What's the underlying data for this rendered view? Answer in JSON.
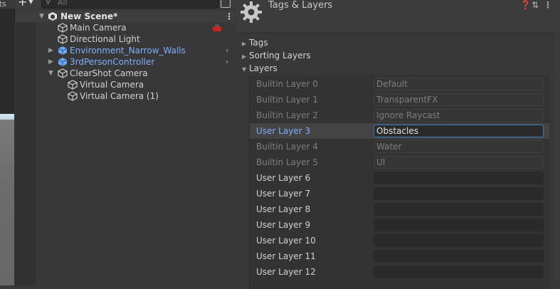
{
  "viewport": {
    "tab_fragment": "ats"
  },
  "hierarchy": {
    "search_placeholder": "All",
    "scene_name": "New Scene*",
    "items": [
      {
        "label": "Main Camera",
        "kind": "object",
        "highlight": false
      },
      {
        "label": "Directional Light",
        "kind": "object",
        "highlight": false
      },
      {
        "label": "Environment_Narrow_Walls",
        "kind": "prefab",
        "highlight": true
      },
      {
        "label": "3rdPersonController",
        "kind": "prefab",
        "highlight": true
      },
      {
        "label": "ClearShot Camera",
        "kind": "object",
        "highlight": false
      },
      {
        "label": "Virtual Camera",
        "kind": "object",
        "highlight": false
      },
      {
        "label": "Virtual Camera (1)",
        "kind": "object",
        "highlight": false
      }
    ]
  },
  "inspector": {
    "title": "Tags & Layers",
    "sections": {
      "tags": "Tags",
      "sorting_layers": "Sorting Layers",
      "layers": "Layers"
    },
    "layers": [
      {
        "name": "Builtin Layer 0",
        "value": "Default",
        "state": "disabled"
      },
      {
        "name": "Builtin Layer 1",
        "value": "TransparentFX",
        "state": "disabled"
      },
      {
        "name": "Builtin Layer 2",
        "value": "Ignore Raycast",
        "state": "disabled"
      },
      {
        "name": "User Layer 3",
        "value": "Obstacles",
        "state": "active"
      },
      {
        "name": "Builtin Layer 4",
        "value": "Water",
        "state": "disabled"
      },
      {
        "name": "Builtin Layer 5",
        "value": "UI",
        "state": "disabled"
      },
      {
        "name": "User Layer 6",
        "value": "",
        "state": "enabled"
      },
      {
        "name": "User Layer 7",
        "value": "",
        "state": "enabled"
      },
      {
        "name": "User Layer 8",
        "value": "",
        "state": "enabled"
      },
      {
        "name": "User Layer 9",
        "value": "",
        "state": "enabled"
      },
      {
        "name": "User Layer 10",
        "value": "",
        "state": "enabled"
      },
      {
        "name": "User Layer 11",
        "value": "",
        "state": "enabled"
      },
      {
        "name": "User Layer 12",
        "value": "",
        "state": "enabled"
      }
    ]
  },
  "colors": {
    "prefab_blue": "#7eaefc",
    "selection_outline": "#3a79bb",
    "panel_bg": "#383838"
  }
}
